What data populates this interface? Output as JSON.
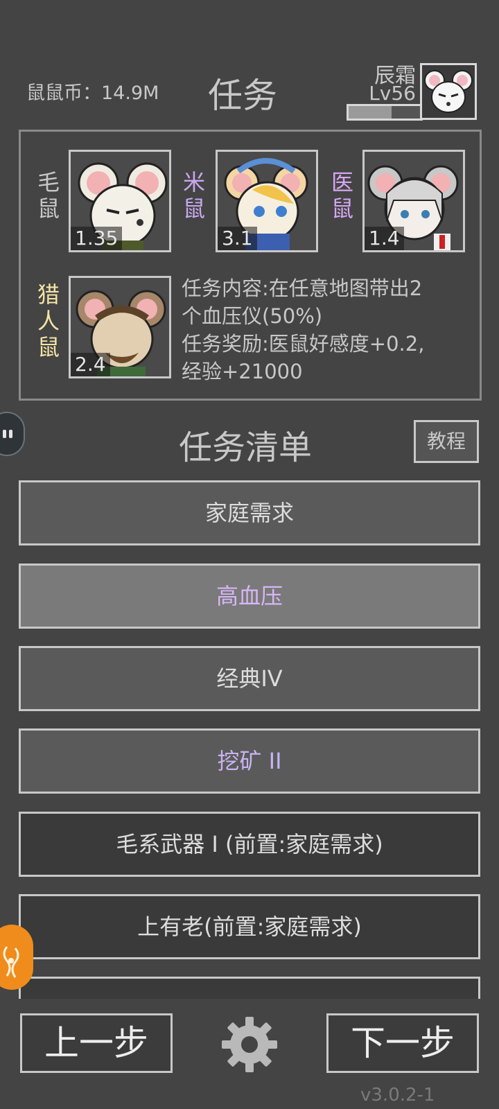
{
  "header": {
    "coins": "鼠鼠币：14.9M",
    "title": "任务",
    "player_name": "辰霜",
    "player_level": "Lv56",
    "xp_progress": 0.6
  },
  "roster": [
    {
      "label_line1": "毛",
      "label_line2": "鼠",
      "value": "1.35",
      "label_color": "#c8c8c8"
    },
    {
      "label_line1": "米",
      "label_line2": "鼠",
      "value": "3.1",
      "label_color": "#c9a8f0"
    },
    {
      "label_line1": "医",
      "label_line2": "鼠",
      "value": "1.4",
      "label_color": "#d6a6f2"
    },
    {
      "label_line1": "猎",
      "label_line2": "人",
      "label_line3": "鼠",
      "value": "2.4",
      "label_color": "#f4e4a4"
    }
  ],
  "mission": {
    "line1": "任务内容:在任意地图带出2",
    "line2": "个血压仪(50%)",
    "line3": "任务奖励:医鼠好感度+0.2,",
    "line4": "经验+21000"
  },
  "list": {
    "title": "任务清单",
    "tutorial_label": "教程",
    "items": [
      {
        "label": "家庭需求",
        "color": "#dddddd",
        "bg": "#5a5a5a"
      },
      {
        "label": "高血压",
        "color": "#d7b6f5",
        "bg": "#7a7a7a"
      },
      {
        "label": "经典IV",
        "color": "#dddddd",
        "bg": "#5a5a5a"
      },
      {
        "label": "挖矿 II",
        "color": "#c8b4f2",
        "bg": "#5a5a5a"
      },
      {
        "label": "毛系武器 I (前置:家庭需求)",
        "color": "#dddddd",
        "bg": "#3a3a3a"
      },
      {
        "label": "上有老(前置:家庭需求)",
        "color": "#dddddd",
        "bg": "#3a3a3a"
      },
      {
        "label": "",
        "color": "#dddddd",
        "bg": "#3a3a3a"
      }
    ]
  },
  "footer": {
    "prev_label": "上一步",
    "next_label": "下一步",
    "version": "v3.0.2-1"
  },
  "icons": {
    "settings": "gear-icon",
    "side_bubble": "chat-bubble-icon",
    "floating": "orange-float-icon"
  }
}
